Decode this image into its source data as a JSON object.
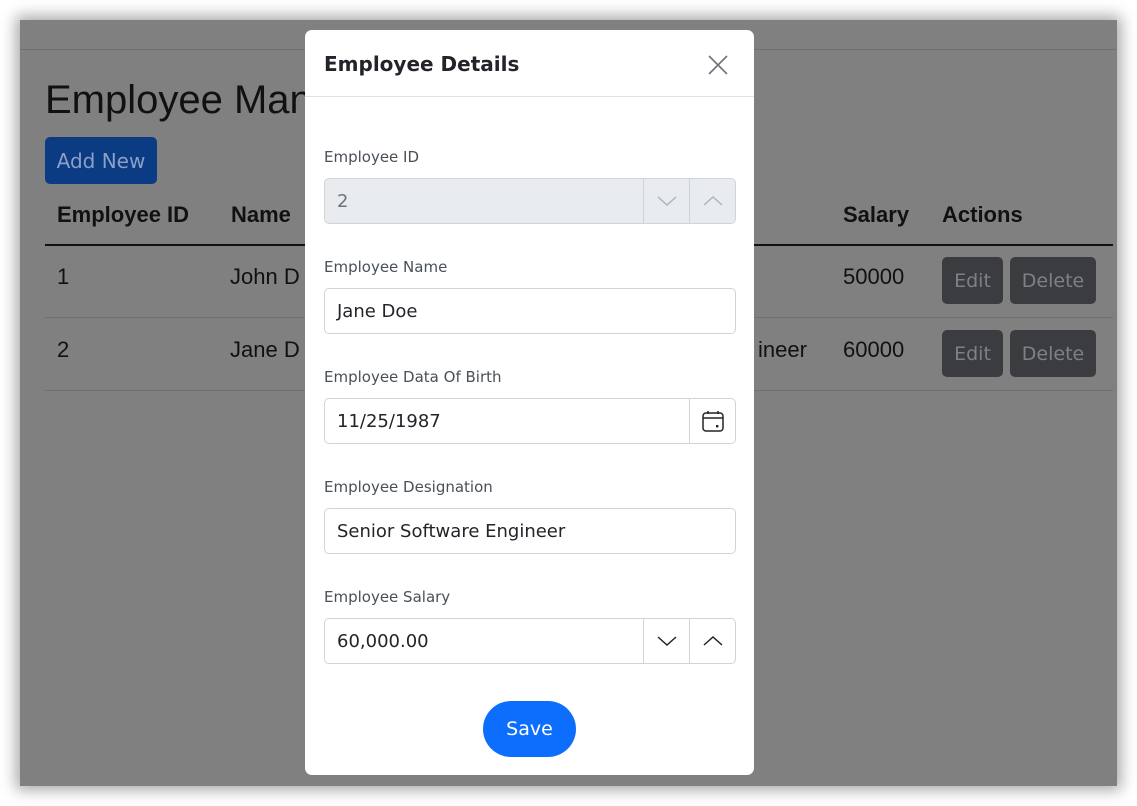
{
  "page": {
    "title_visible": "Employee Man",
    "add_new": "Add New",
    "columns": [
      "Employee ID",
      "Name",
      "Salary",
      "Actions"
    ],
    "rows": [
      {
        "id": "1",
        "name": "John D",
        "designation": "",
        "salary": "50000"
      },
      {
        "id": "2",
        "name": "Jane D",
        "designation": "ineer",
        "salary": "60000"
      }
    ],
    "edit": "Edit",
    "delete": "Delete"
  },
  "modal": {
    "title": "Employee Details",
    "fields": {
      "id": {
        "label": "Employee ID",
        "value": "2"
      },
      "name": {
        "label": "Employee Name",
        "value": "Jane Doe"
      },
      "dob": {
        "label": "Employee Data Of Birth",
        "value": "11/25/1987"
      },
      "designation": {
        "label": "Employee Designation",
        "value": "Senior Software Engineer"
      },
      "salary": {
        "label": "Employee Salary",
        "value": "60,000.00"
      }
    },
    "save": "Save"
  },
  "colors": {
    "primary": "#0d6efd",
    "overlay": "#808080"
  }
}
